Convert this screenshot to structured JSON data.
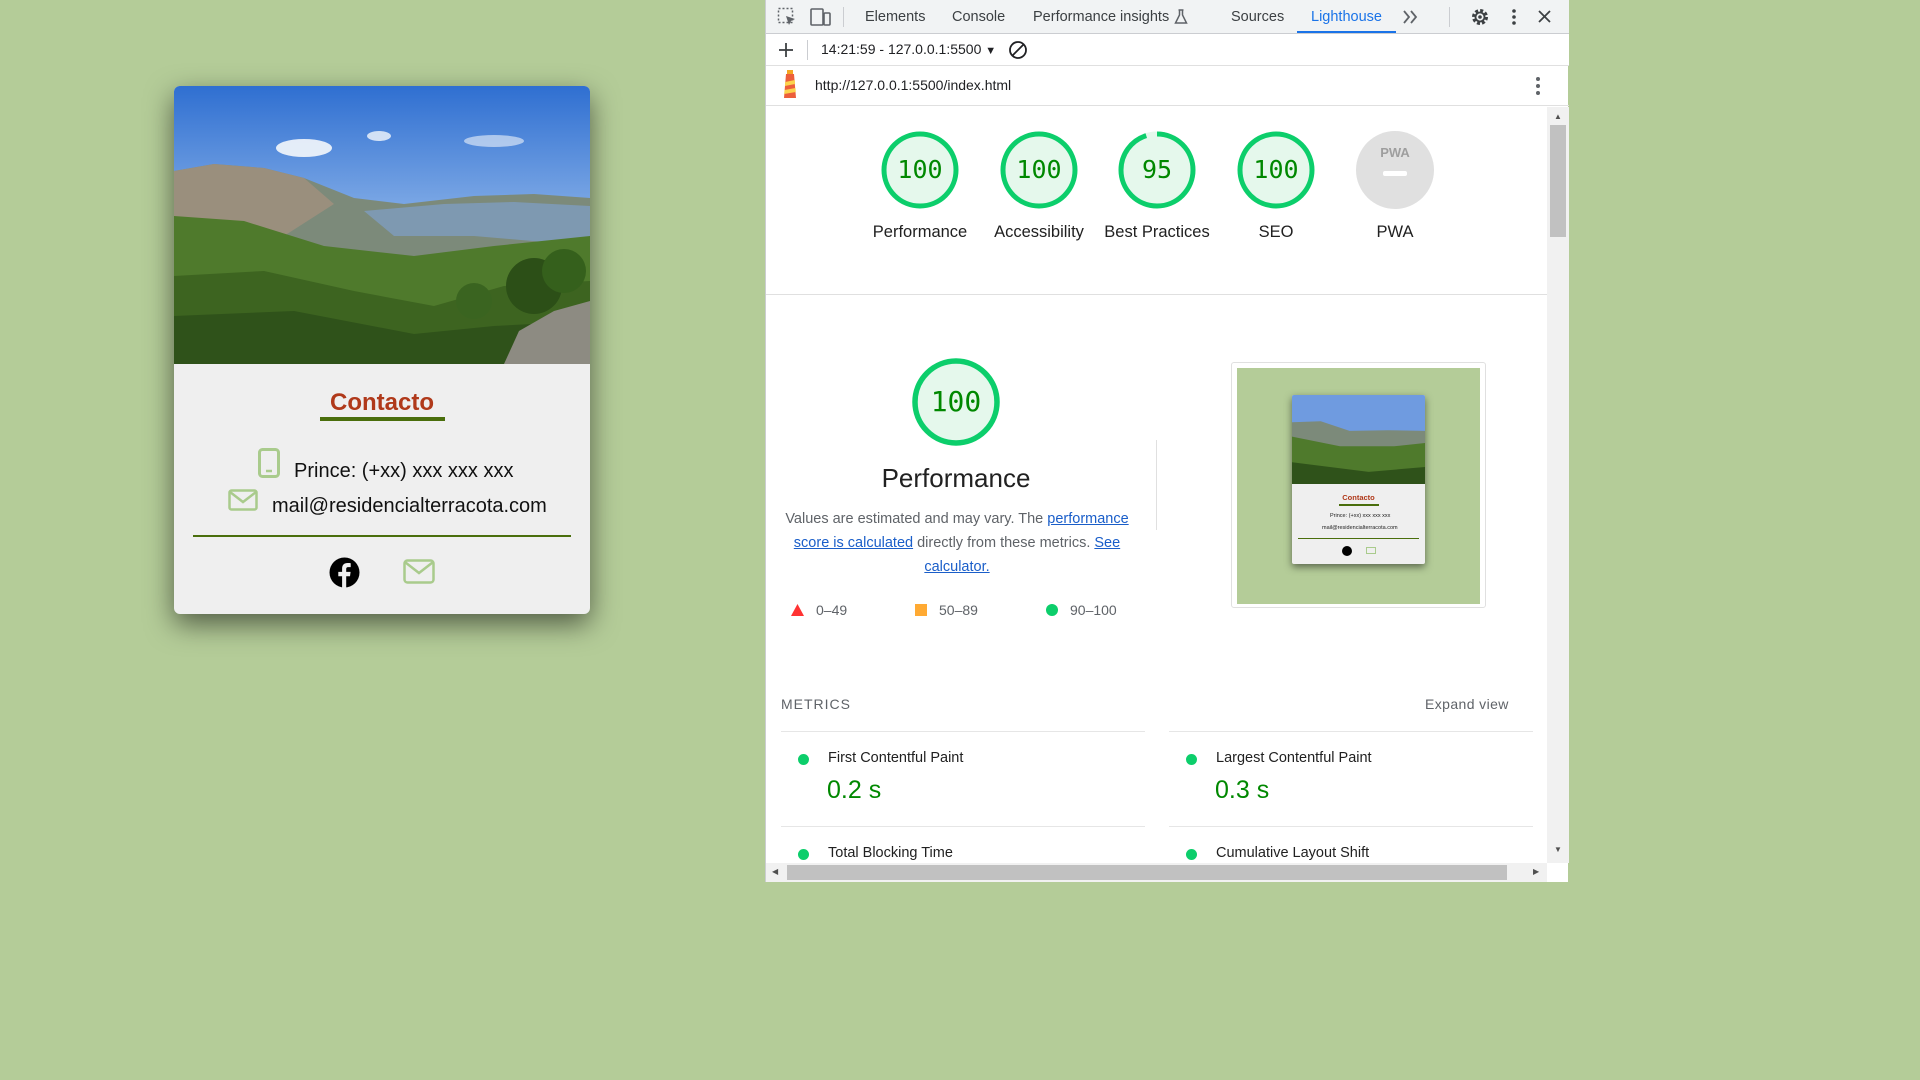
{
  "card": {
    "title": "Contacto",
    "phone": "Prince: (+xx) xxx xxx xxx",
    "email": "mail@residencialterracota.com"
  },
  "devtools": {
    "tabs": [
      "Elements",
      "Console",
      "Performance insights",
      "Sources",
      "Lighthouse"
    ],
    "active_tab": "Lighthouse",
    "report_select": "14:21:59 - 127.0.0.1:5500",
    "url": "http://127.0.0.1:5500/index.html"
  },
  "scores": [
    {
      "label": "Performance",
      "value": "100"
    },
    {
      "label": "Accessibility",
      "value": "100"
    },
    {
      "label": "Best Practices",
      "value": "95"
    },
    {
      "label": "SEO",
      "value": "100"
    },
    {
      "label": "PWA",
      "value": "PWA"
    }
  ],
  "performance": {
    "score": "100",
    "title": "Performance",
    "desc_prefix": "Values are estimated and may vary. The ",
    "link1": "performance score is calculated",
    "desc_middle": " directly from these metrics. ",
    "link2": "See calculator."
  },
  "legend": [
    {
      "range": "0–49",
      "color": "#ff3333",
      "shape": "triangle"
    },
    {
      "range": "50–89",
      "color": "#ffaa33",
      "shape": "square"
    },
    {
      "range": "90–100",
      "color": "#0cce6b",
      "shape": "circle"
    }
  ],
  "metrics": {
    "heading": "METRICS",
    "expand": "Expand view",
    "items": [
      {
        "name": "First Contentful Paint",
        "value": "0.2 s"
      },
      {
        "name": "Largest Contentful Paint",
        "value": "0.3 s"
      },
      {
        "name": "Total Blocking Time",
        "value": ""
      },
      {
        "name": "Cumulative Layout Shift",
        "value": ""
      }
    ]
  },
  "colors": {
    "page_bg": "#b4cc98",
    "title_red": "#b0391a",
    "accent_green": "#4a6e0c",
    "pass_green": "#0cce6b",
    "score_text": "#008800",
    "pass_fill": "#e5f8ec",
    "link_blue": "#1a5ec9",
    "tab_blue": "#1a73e8"
  }
}
